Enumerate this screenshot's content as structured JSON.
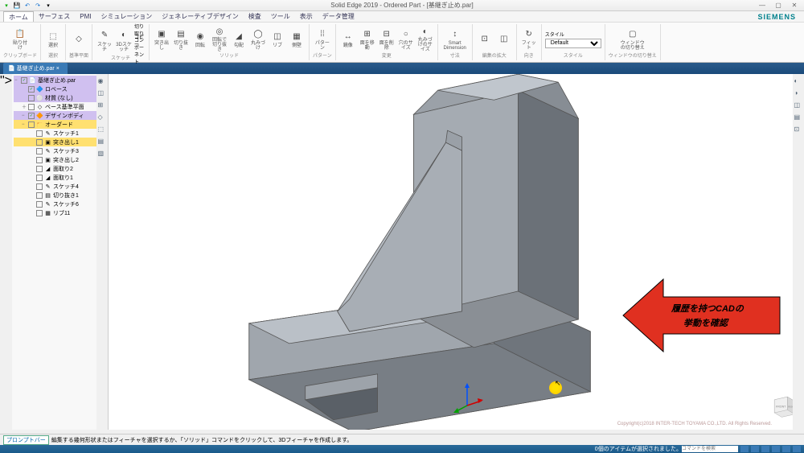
{
  "title": "Solid Edge 2019 - Ordered Part - [基継ぎ止め.par]",
  "brand": "SIEMENS",
  "qat": [
    "save",
    "undo",
    "redo",
    "dropdown"
  ],
  "menus": [
    "ホーム",
    "サーフェス",
    "PMI",
    "シミュレーション",
    "ジェネレーティブデザイン",
    "検査",
    "ツール",
    "表示",
    "データ管理"
  ],
  "ribbon": {
    "g1": {
      "name": "クリップボード",
      "items": [
        {
          "ico": "📋",
          "label": "貼り付け"
        },
        {
          "ico": "✂",
          "label": ""
        }
      ]
    },
    "g2": {
      "name": "選択",
      "items": [
        {
          "ico": "▭",
          "label": "選択"
        }
      ]
    },
    "g3": {
      "name": "基準平面",
      "items": [
        {
          "ico": "◇",
          "label": ""
        }
      ]
    },
    "g4": {
      "name": "スケッチ",
      "items": [
        {
          "ico": "✎",
          "label": "スケッチ"
        },
        {
          "ico": "◐",
          "label": "3Dスケッチ"
        },
        {
          "ico": "⬚",
          "label": "切り取り"
        },
        {
          "ico": "□",
          "label": "コピー"
        },
        {
          "ico": "◧",
          "label": "コンポーネント"
        }
      ]
    },
    "g5": {
      "name": "ソリッド",
      "items": [
        {
          "ico": "▣",
          "label": "突き出し"
        },
        {
          "ico": "▤",
          "label": "切り抜き"
        },
        {
          "ico": "◉",
          "label": "回転"
        },
        {
          "ico": "◎",
          "label": "回転で切り抜き"
        },
        {
          "ico": "◢",
          "label": "勾配"
        },
        {
          "ico": "◯",
          "label": "丸みづけ"
        },
        {
          "ico": "◫",
          "label": "リブ"
        },
        {
          "ico": "▦",
          "label": "側壁"
        }
      ]
    },
    "g6": {
      "name": "パターン",
      "items": [
        {
          "ico": "⁞",
          "label": "パターン"
        },
        {
          "ico": "▽",
          "label": ""
        }
      ]
    },
    "g7": {
      "name": "変更",
      "items": [
        {
          "ico": "↔",
          "label": "鏡像"
        },
        {
          "ico": "⊞",
          "label": "面を移動"
        },
        {
          "ico": "⊟",
          "label": "面を削除"
        },
        {
          "ico": "○",
          "label": "穴のサイズ"
        },
        {
          "ico": "◐",
          "label": "丸みづけのサイズ"
        }
      ]
    },
    "g8": {
      "name": "寸法",
      "items": [
        {
          "ico": "↕",
          "label": "Smart Dimension"
        }
      ]
    },
    "g9": {
      "name": "編集の拡大",
      "items": [
        {
          "ico": "⊡",
          "label": ""
        },
        {
          "ico": "◫",
          "label": ""
        }
      ]
    },
    "g10": {
      "name": "向き",
      "items": [
        {
          "ico": "↻",
          "label": "フィット"
        }
      ]
    },
    "g11": {
      "name": "スタイル",
      "label": "スタイル",
      "value": "Default"
    },
    "g12": {
      "name": "ウィンドウの切り替え",
      "items": [
        {
          "ico": "▢",
          "label": "ウィンドウの切り替え"
        }
      ]
    }
  },
  "doctab": "基継ぎ止め.par",
  "tree": [
    {
      "exp": "−",
      "chk": "✓",
      "ico": "📄",
      "label": "基継ぎ止め.par",
      "ind": 0,
      "hl": "purple"
    },
    {
      "exp": "",
      "chk": "✓",
      "ico": "🔷",
      "label": "ロベース",
      "ind": 1,
      "hl": "purple"
    },
    {
      "exp": "",
      "chk": "",
      "ico": "⚪",
      "label": "材質 (なし)",
      "ind": 1,
      "hl": "purple"
    },
    {
      "exp": "＋",
      "chk": "",
      "ico": "◇",
      "label": "ベース基準平面",
      "ind": 1
    },
    {
      "exp": "−",
      "chk": "✓",
      "ico": "🔶",
      "label": "デザインボディ",
      "ind": 1,
      "hl": "purple"
    },
    {
      "exp": "−",
      "chk": "",
      "ico": "📁",
      "label": "オーダード",
      "ind": 1,
      "hl": "yellow"
    },
    {
      "exp": "",
      "chk": "",
      "ico": "✎",
      "label": "スケッチ1",
      "ind": 2
    },
    {
      "exp": "",
      "chk": "",
      "ico": "▣",
      "label": "突き出し1",
      "ind": 2,
      "hl": "yellow"
    },
    {
      "exp": "",
      "chk": "",
      "ico": "✎",
      "label": "スケッチ3",
      "ind": 2
    },
    {
      "exp": "",
      "chk": "",
      "ico": "▣",
      "label": "突き出し2",
      "ind": 2
    },
    {
      "exp": "",
      "chk": "",
      "ico": "◢",
      "label": "面取り2",
      "ind": 2
    },
    {
      "exp": "",
      "chk": "",
      "ico": "◢",
      "label": "面取り1",
      "ind": 2
    },
    {
      "exp": "",
      "chk": "",
      "ico": "✎",
      "label": "スケッチ4",
      "ind": 2
    },
    {
      "exp": "",
      "chk": "",
      "ico": "▤",
      "label": "切り抜き1",
      "ind": 2
    },
    {
      "exp": "",
      "chk": "",
      "ico": "✎",
      "label": "スケッチ6",
      "ind": 2
    },
    {
      "exp": "",
      "chk": "",
      "ico": "▦",
      "label": "リブ11",
      "ind": 2
    }
  ],
  "left_tools": [
    "◉",
    "◫",
    "⊞",
    "◇",
    "⬚",
    "▤",
    "▧"
  ],
  "right_tools": [
    "◐",
    "◑",
    "◫",
    "▤",
    "⊡"
  ],
  "callout": {
    "line1": "履歴を持つCADの",
    "line2": "挙動を確認"
  },
  "viewcube": {
    "front": "FRONT",
    "right": "RIGHT"
  },
  "prompt": {
    "label": "プロンプトバー",
    "text": "編集する幾何形状またはフィーチャを選択するか、「ソリッド」コマンドをクリックして、3Dフィーチャを作成します。"
  },
  "copyright": "Copyright(c)2018 INTER-TECH TOYAMA CO.,LTD. All Rights Reserved.",
  "status": {
    "center": "0個のアイテムが選択されました。",
    "input_ph": "コマンドを検索"
  }
}
